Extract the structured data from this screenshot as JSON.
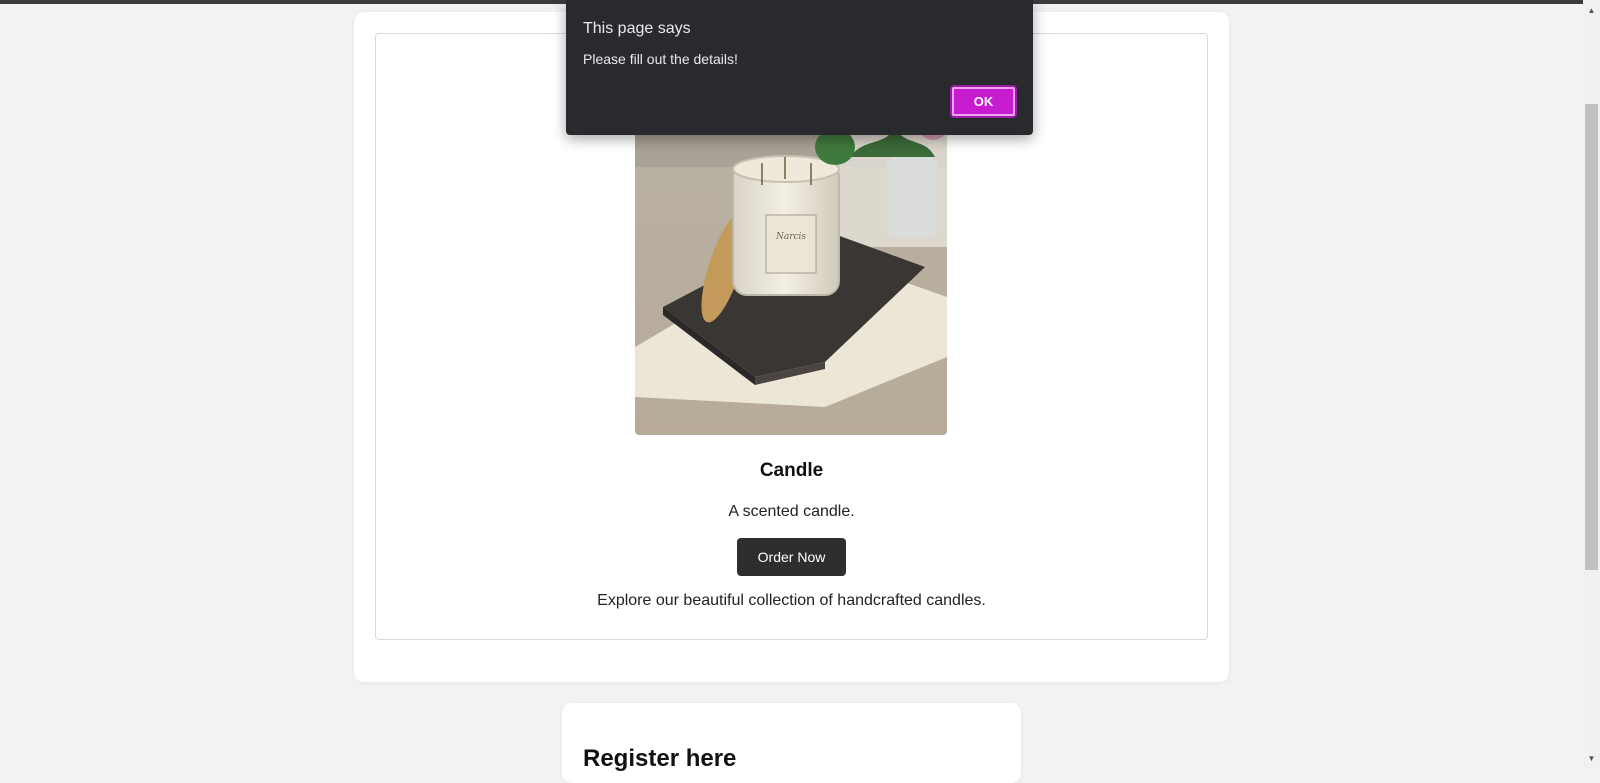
{
  "dialog": {
    "title": "This page says",
    "message": "Please fill out the details!",
    "ok_label": "OK",
    "ok_color": "#c71ccf"
  },
  "product": {
    "image_name": "candle-photo",
    "title": "Candle",
    "description": "A scented candle.",
    "order_label": "Order Now",
    "collection_text": "Explore our beautiful collection of handcrafted candles."
  },
  "register": {
    "heading": "Register here"
  },
  "scrollbar": {
    "up_icon": "▲",
    "down_icon": "▼"
  }
}
